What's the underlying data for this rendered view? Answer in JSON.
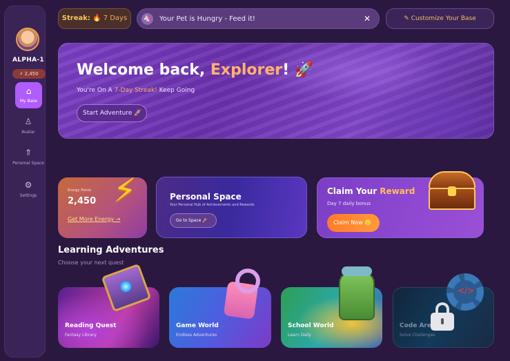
{
  "sidebar": {
    "username": "ALPHA-1",
    "coins": "⚡ 2,450",
    "items": [
      {
        "label": "My Base",
        "icon": "home-icon"
      },
      {
        "label": "Avatar",
        "icon": "user-icon"
      },
      {
        "label": "Personal Space",
        "icon": "rocket-icon"
      },
      {
        "label": "Settings",
        "icon": "gear-icon"
      }
    ]
  },
  "topbar": {
    "streak_label": "Streak:",
    "streak_value": "🔥 7 Days",
    "notification": "Your Pet is Hungry - Feed it!",
    "customize_label": "Customize Your Base"
  },
  "hero": {
    "title_prefix": "Welcome back, ",
    "title_highlight": "Explorer",
    "title_suffix": "! 🚀",
    "subtitle_prefix": "You're On A ",
    "subtitle_highlight": "7-Day Streak!",
    "subtitle_suffix": " Keep Going",
    "button_label": "Start Adventure 🚀"
  },
  "energy": {
    "title": "Energy Points",
    "value": "2,450",
    "link": "Get More Energy →"
  },
  "personal_space": {
    "title": "Personal Space",
    "subtitle": "Your Personal Hub of Achievements and Rewards",
    "button_label": "Go to Space 🚀"
  },
  "reward": {
    "title_prefix": "Claim Your ",
    "title_highlight": "Reward",
    "subtitle": "Day 7 daily bonus",
    "button_label": "Claim Now 🪙"
  },
  "learning": {
    "title": "Learning Adventures",
    "subtitle": "Choose your next quest",
    "cards": [
      {
        "name": "Reading Quest",
        "desc": "Fantasy Library"
      },
      {
        "name": "Game World",
        "desc": "Endless Adventures"
      },
      {
        "name": "School World",
        "desc": "Learn Daily"
      },
      {
        "name": "Code Arena",
        "desc": "Solve Challenges"
      }
    ]
  },
  "colors": {
    "background": "#2a1840",
    "accent_purple": "#b05cff",
    "accent_orange": "#ffb36b",
    "gold": "#e8c062"
  }
}
